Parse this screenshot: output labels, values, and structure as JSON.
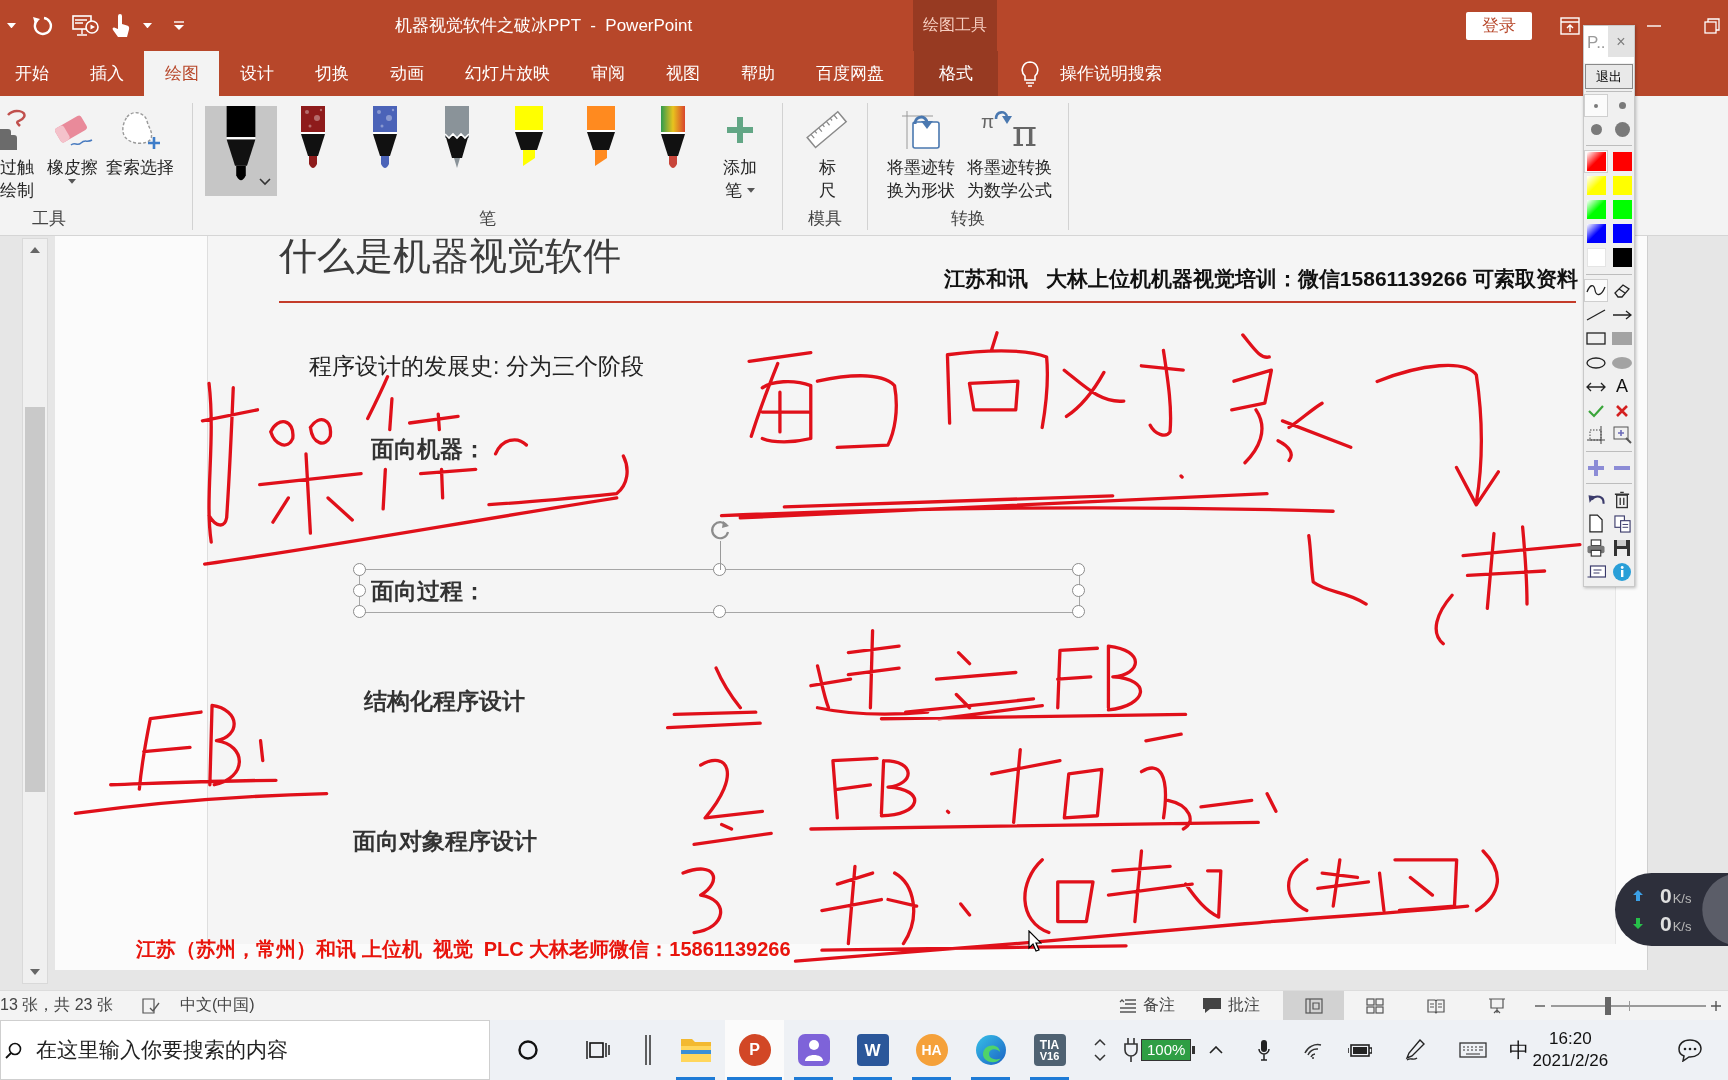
{
  "title_bar": {
    "title": "机器视觉软件之破冰PPT  -  PowerPoint",
    "contextual_group": "绘图工具",
    "sign_in": "登录"
  },
  "tabs": [
    {
      "label": "开始",
      "selected": false,
      "contextual": false
    },
    {
      "label": "插入",
      "selected": false,
      "contextual": false
    },
    {
      "label": "绘图",
      "selected": true,
      "contextual": false
    },
    {
      "label": "设计",
      "selected": false,
      "contextual": false
    },
    {
      "label": "切换",
      "selected": false,
      "contextual": false
    },
    {
      "label": "动画",
      "selected": false,
      "contextual": false
    },
    {
      "label": "幻灯片放映",
      "selected": false,
      "contextual": false
    },
    {
      "label": "审阅",
      "selected": false,
      "contextual": false
    },
    {
      "label": "视图",
      "selected": false,
      "contextual": false
    },
    {
      "label": "帮助",
      "selected": false,
      "contextual": false
    },
    {
      "label": "百度网盘",
      "selected": false,
      "contextual": false
    },
    {
      "label": "格式",
      "selected": false,
      "contextual": true
    }
  ],
  "tell_me": "操作说明搜索",
  "ribbon_groups": [
    {
      "label": "工具",
      "buttons": [
        {
          "kind": "touch",
          "lines": [
            "过触",
            "绘制"
          ],
          "dropdown": false
        },
        {
          "kind": "eraser",
          "lines": [
            "橡皮擦"
          ],
          "dropdown": true
        },
        {
          "kind": "lasso",
          "lines": [
            "套索选择"
          ],
          "dropdown": false
        }
      ]
    },
    {
      "label": "笔",
      "pens": [
        {
          "kind": "pen",
          "color": "#000000",
          "selected": true
        },
        {
          "kind": "texture",
          "color": "#8e1b1b",
          "selected": false
        },
        {
          "kind": "texture",
          "color": "#4b63b8",
          "selected": false
        },
        {
          "kind": "pencil",
          "color": "#8a9399",
          "selected": false
        },
        {
          "kind": "highlighter",
          "color": "#ffff00",
          "selected": false
        },
        {
          "kind": "highlighter",
          "color": "#ff8a1f",
          "selected": false
        },
        {
          "kind": "rainbow",
          "color": "#c8453a",
          "selected": false
        }
      ],
      "buttons": [
        {
          "kind": "add",
          "lines": [
            "添加",
            "笔"
          ],
          "dropdown": true
        }
      ]
    },
    {
      "label": "模具",
      "buttons": [
        {
          "kind": "ruler",
          "lines": [
            "标",
            "尺"
          ],
          "dropdown": false
        }
      ]
    },
    {
      "label": "转换",
      "buttons": [
        {
          "kind": "shape",
          "lines": [
            "将墨迹转",
            "换为形状"
          ],
          "dropdown": false
        },
        {
          "kind": "math",
          "lines": [
            "将墨迹转换",
            "为数学公式"
          ],
          "dropdown": false,
          "glyphs": [
            "π",
            "π"
          ]
        }
      ]
    }
  ],
  "slide": {
    "title": "什么是机器视觉软件",
    "banner": "江苏和讯   大林上位机机器视觉培训：微信15861139266 可索取资料",
    "intro": "程序设计的发展史: 分为三个阶段",
    "items": [
      {
        "text": "面向机器：",
        "selected": false
      },
      {
        "text": "面向过程：",
        "selected": true
      },
      {
        "text": "结构化程序设计",
        "selected": false
      },
      {
        "text": "面向对象程序设计",
        "selected": false
      }
    ],
    "footer": "江苏（苏州，常州）和讯 上位机  视觉  PLC 大林老师微信：15861139266"
  },
  "status_bar": {
    "slide_counter": "13 张，共 23 张",
    "language": "中文(中国)",
    "notes": "备注",
    "comments": "批注",
    "views": [
      {
        "kind": "normal",
        "selected": true
      },
      {
        "kind": "sorter",
        "selected": false
      },
      {
        "kind": "reading",
        "selected": false
      },
      {
        "kind": "show",
        "selected": false
      }
    ],
    "zoom": {
      "level": 0.37
    }
  },
  "taskbar": {
    "search_placeholder": "在这里输入你要搜索的内容",
    "apps": [
      {
        "kind": "explorer",
        "selected": false,
        "running": true
      },
      {
        "kind": "powerpoint",
        "label": "P",
        "selected": true,
        "running": true
      },
      {
        "kind": "people",
        "selected": false,
        "running": true
      },
      {
        "kind": "word",
        "label": "W",
        "selected": false,
        "running": true
      },
      {
        "kind": "ha",
        "label": "HA",
        "selected": false,
        "running": true
      },
      {
        "kind": "edge",
        "selected": false,
        "running": true
      },
      {
        "kind": "tia",
        "label": "TIA",
        "sublabel": "V16",
        "selected": false,
        "running": true
      }
    ],
    "battery": "100%",
    "ime": "中",
    "time": "16:20",
    "date": "2021/2/26"
  },
  "pen_palette": {
    "title": "P..",
    "close": "×",
    "exit": "退出",
    "sizes": [
      {
        "selected": true
      },
      {
        "selected": false
      },
      {
        "selected": false
      },
      {
        "selected": false
      }
    ],
    "colors": [
      {
        "kind": "gradient",
        "color": "#ff0000",
        "selected": true
      },
      {
        "kind": "solid",
        "color": "#ff0000",
        "selected": false
      },
      {
        "kind": "gradient",
        "color": "#ffff00",
        "selected": false
      },
      {
        "kind": "solid",
        "color": "#ffff00",
        "selected": false
      },
      {
        "kind": "gradient",
        "color": "#00ff00",
        "selected": false
      },
      {
        "kind": "solid",
        "color": "#00ff00",
        "selected": false
      },
      {
        "kind": "gradient",
        "color": "#0000ff",
        "selected": false
      },
      {
        "kind": "solid",
        "color": "#0000ff",
        "selected": false
      },
      {
        "kind": "solid",
        "color": "#ffffff",
        "selected": false
      },
      {
        "kind": "solid",
        "color": "#000000",
        "selected": false
      }
    ],
    "tools": [
      {
        "kind": "freehand",
        "selected": true
      },
      {
        "kind": "eraser",
        "selected": false
      },
      {
        "kind": "line",
        "selected": false
      },
      {
        "kind": "arrow",
        "selected": false
      },
      {
        "kind": "rectangle",
        "selected": false
      },
      {
        "kind": "filledrect",
        "selected": false
      },
      {
        "kind": "ellipse",
        "selected": false
      },
      {
        "kind": "filledellipse",
        "selected": false
      },
      {
        "kind": "doublearrow",
        "selected": false
      },
      {
        "kind": "text",
        "label": "A",
        "selected": false
      },
      {
        "kind": "check",
        "selected": false
      },
      {
        "kind": "cross",
        "selected": false
      },
      {
        "kind": "crop",
        "selected": false
      },
      {
        "kind": "zoom",
        "selected": false
      }
    ]
  },
  "net_meter": {
    "rows": [
      {
        "kind": "upload",
        "value": "0",
        "unit": "K/s"
      },
      {
        "kind": "download",
        "value": "0",
        "unit": "K/s"
      }
    ]
  }
}
